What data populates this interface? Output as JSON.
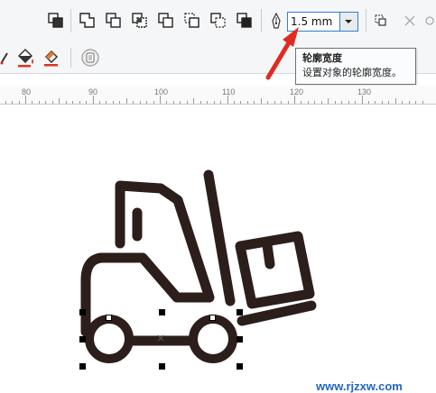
{
  "toolbar": {
    "outline_width_value": "1.5 mm",
    "icons": [
      "order-to-front-icon",
      "weld-icon",
      "trim-icon",
      "intersect-icon",
      "simplify-icon",
      "front-minus-back-icon",
      "back-minus-front-icon",
      "boundary-icon",
      "pen-outline-icon",
      "dropdown-arrow-icon"
    ]
  },
  "tooltip": {
    "title": "轮廓宽度",
    "description": "设置对象的轮廓宽度。"
  },
  "ruler": {
    "labels": [
      "80",
      "90",
      "100",
      "110",
      "120",
      "130"
    ]
  },
  "watermark": {
    "text": "www.rjzxw.com"
  },
  "colors": {
    "accent": "#2f7fd3",
    "arrow": "#e02b22",
    "artwork": "#2b1e1b",
    "watermark": "#1f66c4"
  }
}
